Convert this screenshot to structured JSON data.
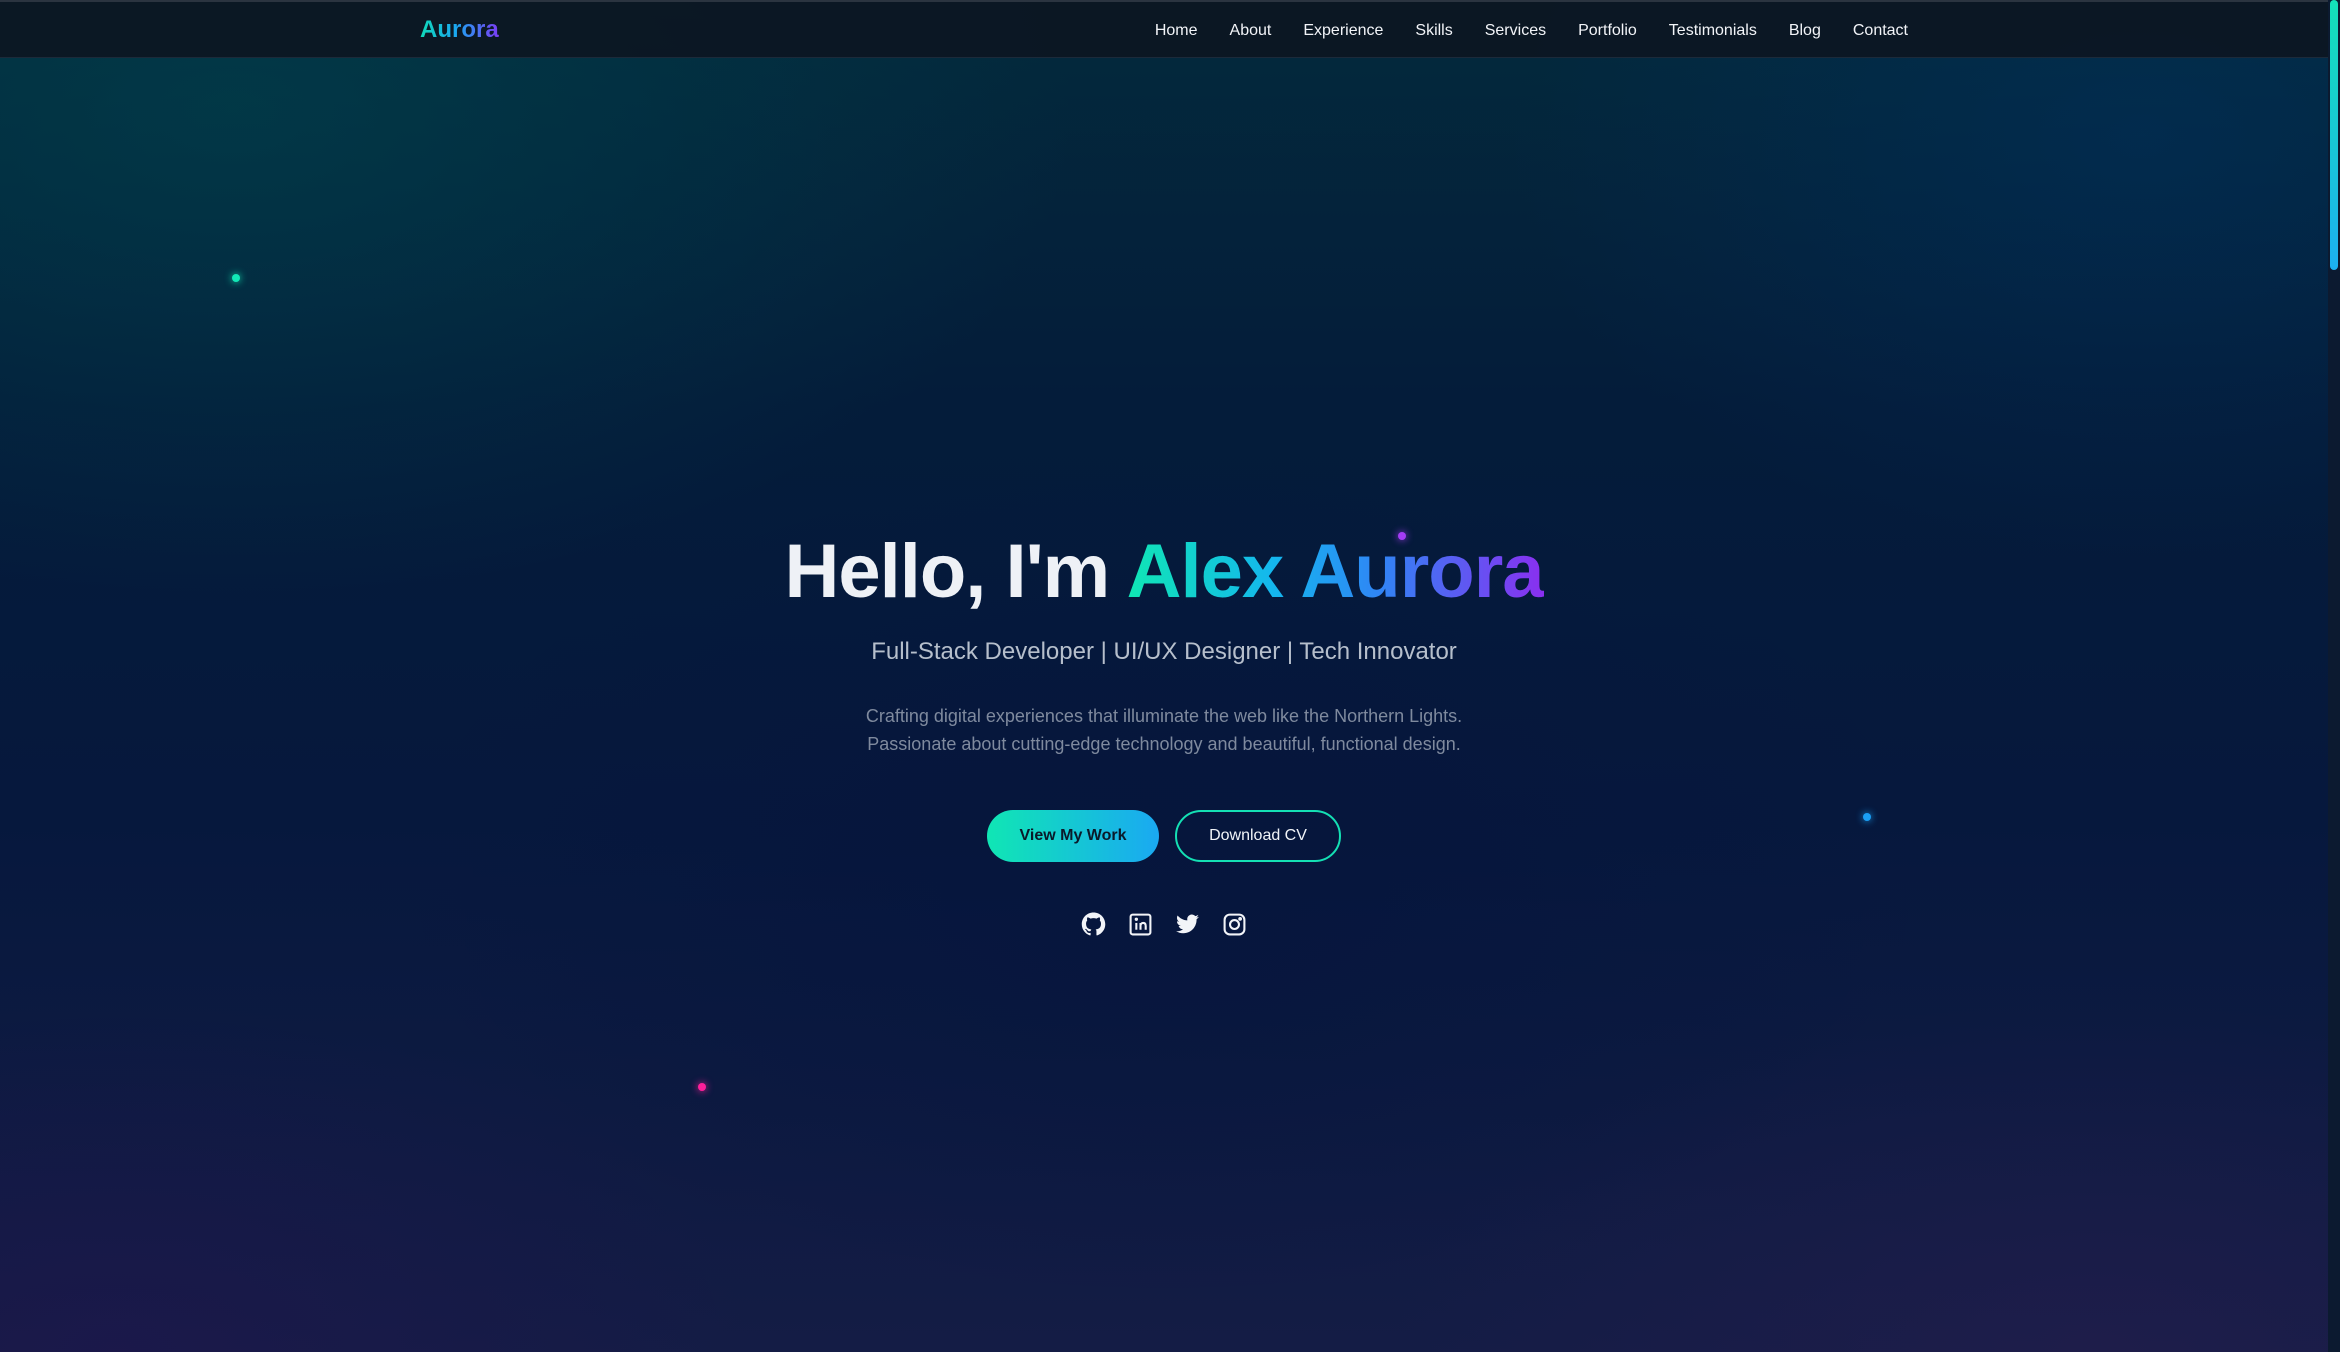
{
  "brand": {
    "name": "Aurora"
  },
  "nav": {
    "items": [
      {
        "label": "Home"
      },
      {
        "label": "About"
      },
      {
        "label": "Experience"
      },
      {
        "label": "Skills"
      },
      {
        "label": "Services"
      },
      {
        "label": "Portfolio"
      },
      {
        "label": "Testimonials"
      },
      {
        "label": "Blog"
      },
      {
        "label": "Contact"
      }
    ]
  },
  "hero": {
    "greeting": "Hello, I'm",
    "name": "Alex Aurora",
    "subtitle": "Full-Stack Developer | UI/UX Designer | Tech Innovator",
    "description_line1": "Crafting digital experiences that illuminate the web like the Northern Lights.",
    "description_line2": "Passionate about cutting-edge technology and beautiful, functional design.",
    "primary_button": "View My Work",
    "secondary_button": "Download CV"
  },
  "social": {
    "icons": [
      "github-icon",
      "linkedin-icon",
      "twitter-icon",
      "instagram-icon"
    ]
  },
  "colors": {
    "accent_teal": "#10e6b4",
    "accent_blue": "#1aa9f2",
    "accent_purple": "#8a2ff0",
    "accent_pink": "#ff1f9a",
    "background": "#061630"
  }
}
